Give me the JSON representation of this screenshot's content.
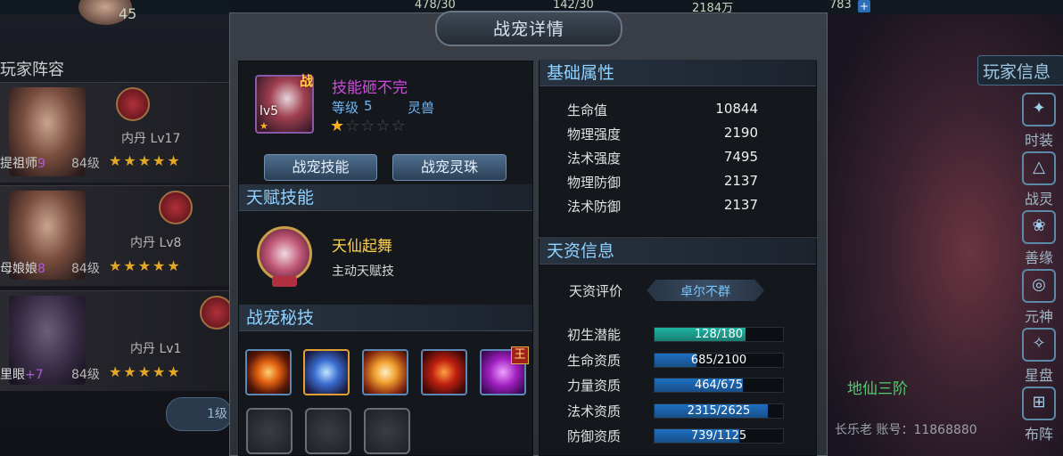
{
  "topbar": {
    "stat1": "478/30",
    "stat2": "142/30",
    "stat3": "2184万",
    "stat4": "783",
    "level_left": "45"
  },
  "left_bg": {
    "title": "玩家阵容",
    "rows": [
      {
        "name": "提祖师",
        "suffix": "9",
        "level": "84级",
        "neidan": "内丹 Lv17"
      },
      {
        "name": "母娘娘",
        "suffix": "8",
        "level": "84级",
        "neidan": "内丹 Lv8"
      },
      {
        "name": "里眼",
        "suffix": "+7",
        "level": "84级",
        "neidan": "内丹 Lv1"
      }
    ],
    "bottom_label": "1级"
  },
  "right_bg": {
    "title": "玩家信息",
    "side_menu": [
      "时装",
      "战灵",
      "善缘",
      "元神",
      "星盘",
      "布阵"
    ],
    "scene_label": "地仙三阶",
    "account_text": "长乐老 账号：11868880"
  },
  "panel": {
    "title": "战宠详情",
    "pet": {
      "name": "技能砸不完",
      "level_label": "等级",
      "level_value": "5",
      "type": "灵兽",
      "portrait_level": "lv5",
      "badge": "战",
      "stars_filled": 1,
      "stars_total": 5
    },
    "buttons": {
      "skills": "战宠技能",
      "orbs": "战宠灵珠"
    },
    "talent": {
      "header": "天赋技能",
      "name": "天仙起舞",
      "desc": "主动天赋技"
    },
    "secret": {
      "header": "战宠秘技",
      "skills": [
        "eye-skill-icon",
        "blue-vortex-skill-icon",
        "golden-slash-skill-icon",
        "fire-skill-icon",
        "purple-demon-skill-icon"
      ],
      "king_badge": "王"
    },
    "base_attrs": {
      "header": "基础属性",
      "items": [
        {
          "label": "生命值",
          "value": "10844"
        },
        {
          "label": "物理强度",
          "value": "2190"
        },
        {
          "label": "法术强度",
          "value": "7495"
        },
        {
          "label": "物理防御",
          "value": "2137"
        },
        {
          "label": "法术防御",
          "value": "2137"
        }
      ]
    },
    "aptitude": {
      "header": "天资信息",
      "rating_label": "天资评价",
      "rating_value": "卓尔不群",
      "bars": [
        {
          "label": "初生潜能",
          "text": "128/180",
          "fraction": 0.711,
          "color": "#1fb5a3"
        },
        {
          "label": "生命资质",
          "text": "685/2100",
          "fraction": 0.326,
          "color": "#1e6fc2"
        },
        {
          "label": "力量资质",
          "text": "464/675",
          "fraction": 0.687,
          "color": "#1e6fc2"
        },
        {
          "label": "法术资质",
          "text": "2315/2625",
          "fraction": 0.882,
          "color": "#1e6fc2"
        },
        {
          "label": "防御资质",
          "text": "739/1125",
          "fraction": 0.657,
          "color": "#1e6fc2"
        }
      ]
    }
  }
}
